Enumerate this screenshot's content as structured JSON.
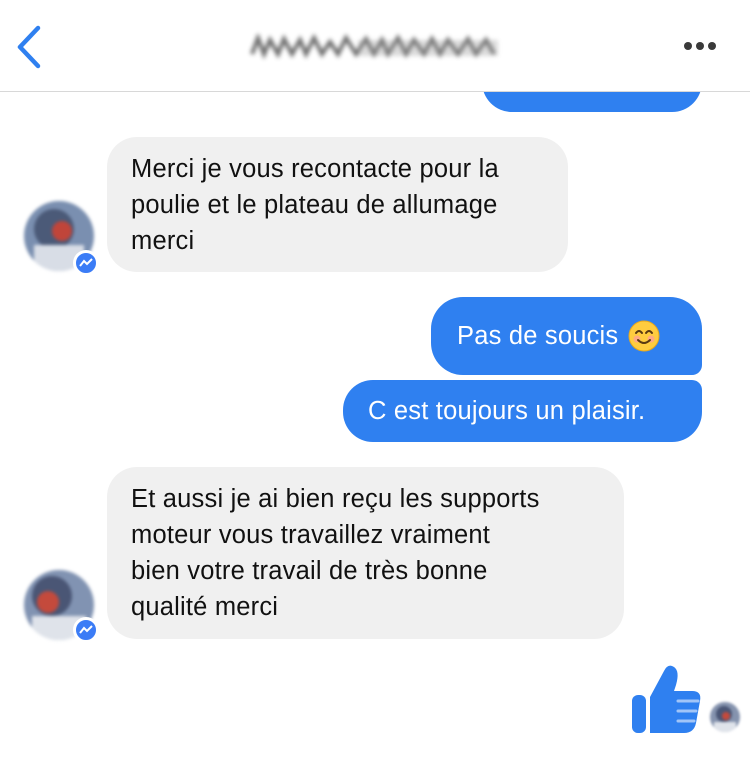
{
  "header": {
    "back_icon": "chevron-left-icon",
    "contact_name": "",
    "more_icon": "more-horizontal-icon"
  },
  "messages": [
    {
      "direction": "outgoing",
      "text": ""
    },
    {
      "direction": "incoming",
      "lines": [
        "Merci je vous recontacte pour la",
        "poulie et le plateau de allumage",
        "merci"
      ]
    },
    {
      "direction": "outgoing",
      "text": "Pas de soucis",
      "emoji": "😊"
    },
    {
      "direction": "outgoing",
      "text": "C est toujours un plaisir."
    },
    {
      "direction": "incoming",
      "lines": [
        "Et  aussi  je ai bien reçu les supports",
        "moteur vous travaillez  vraiment",
        "bien votre travail  de très bonne",
        "qualité  merci"
      ]
    }
  ],
  "reaction": {
    "icon": "thumbs-up-icon"
  },
  "colors": {
    "outgoing": "#2f80f0",
    "incoming": "#f0f0f0",
    "accent": "#2f80f0"
  }
}
